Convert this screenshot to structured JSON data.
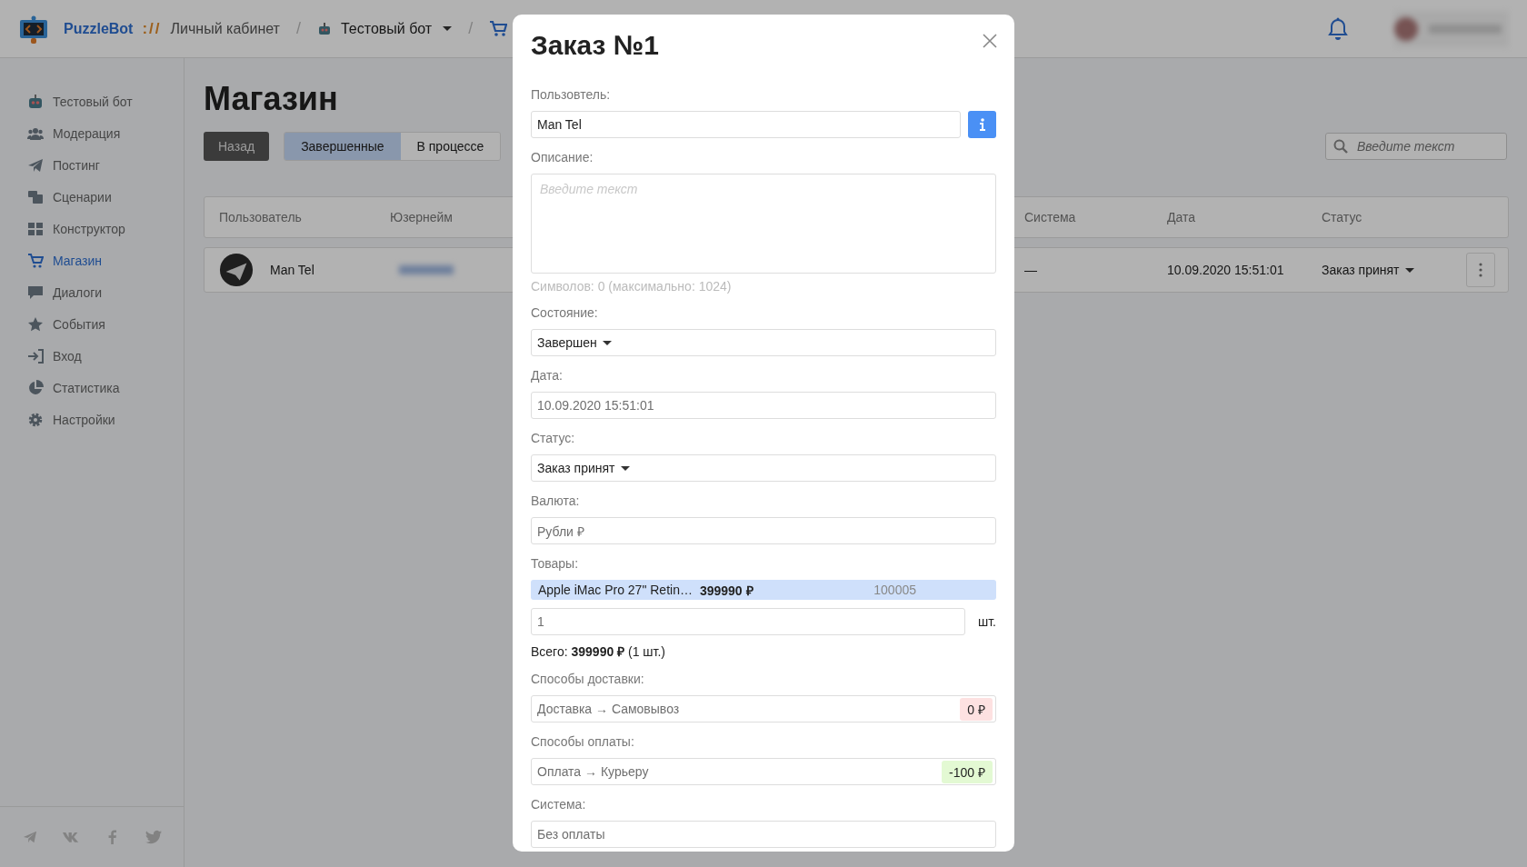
{
  "header": {
    "brand": "PuzzleBot",
    "brand_separator": "://",
    "crumb_separator": "/",
    "breadcrumbs": [
      {
        "kind": "link",
        "label": "Личный кабинет"
      },
      {
        "kind": "bot",
        "label": "Тестовый бот"
      },
      {
        "kind": "cart"
      }
    ]
  },
  "sidebar": {
    "items": [
      {
        "label": "Тестовый бот",
        "selected": false
      },
      {
        "label": "Модерация",
        "selected": false
      },
      {
        "label": "Постинг",
        "selected": false
      },
      {
        "label": "Сценарии",
        "selected": false
      },
      {
        "label": "Конструктор",
        "selected": false
      },
      {
        "label": "Магазин",
        "selected": true
      },
      {
        "label": "Диалоги",
        "selected": false
      },
      {
        "label": "События",
        "selected": false
      },
      {
        "label": "Вход",
        "selected": false
      },
      {
        "label": "Статистика",
        "selected": false
      },
      {
        "label": "Настройки",
        "selected": false
      }
    ]
  },
  "page": {
    "title": "Магазин",
    "back_button": "Назад",
    "tabs": [
      {
        "label": "Завершенные",
        "selected": true
      },
      {
        "label": "В процессе",
        "selected": false
      }
    ],
    "search": {
      "placeholder": "Введите текст"
    },
    "table": {
      "columns": [
        "Пользователь",
        "Юзернейм",
        "Система",
        "Дата",
        "Статус"
      ],
      "rows": [
        {
          "user": "Man Tel",
          "system": "—",
          "date": "10.09.2020 15:51:01",
          "status": "Заказ принят"
        }
      ]
    }
  },
  "modal": {
    "title": "Заказ №1",
    "fields": [
      {
        "kind": "user",
        "label": "Пользовтель:",
        "value": "Man Tel"
      },
      {
        "kind": "textarea",
        "label": "Описание:",
        "placeholder": "Введите текст",
        "counter": "Символов: 0 (максимально: 1024)"
      },
      {
        "kind": "select",
        "label": "Состояние:",
        "value": "Завершен"
      },
      {
        "kind": "input",
        "label": "Дата:",
        "value": "10.09.2020 15:51:01",
        "disabled": true
      },
      {
        "kind": "select",
        "label": "Статус:",
        "value": "Заказ принят"
      },
      {
        "kind": "input",
        "label": "Валюта:",
        "value": "Рубли ₽",
        "disabled": true
      },
      {
        "kind": "products",
        "label": "Товары:",
        "items": [
          {
            "name": "Apple iMac Pro 27\" Retin…",
            "price": "399990 ₽",
            "code": "100005"
          }
        ],
        "quantity": "1",
        "unit": "шт.",
        "total": "Всего: **399990 ₽** (1 шт.)"
      },
      {
        "kind": "tagged",
        "label": "Способы доставки:",
        "value": "Доставка → Самовывоз",
        "tag": "0 ₽",
        "color": "#fde1e1"
      },
      {
        "kind": "tagged",
        "label": "Способы оплаты:",
        "value": "Оплата → Курьеру",
        "tag": "-100 ₽",
        "color": "#e3f9d3"
      },
      {
        "kind": "input",
        "label": "Система:",
        "value": "Без оплаты",
        "disabled": true
      }
    ]
  }
}
